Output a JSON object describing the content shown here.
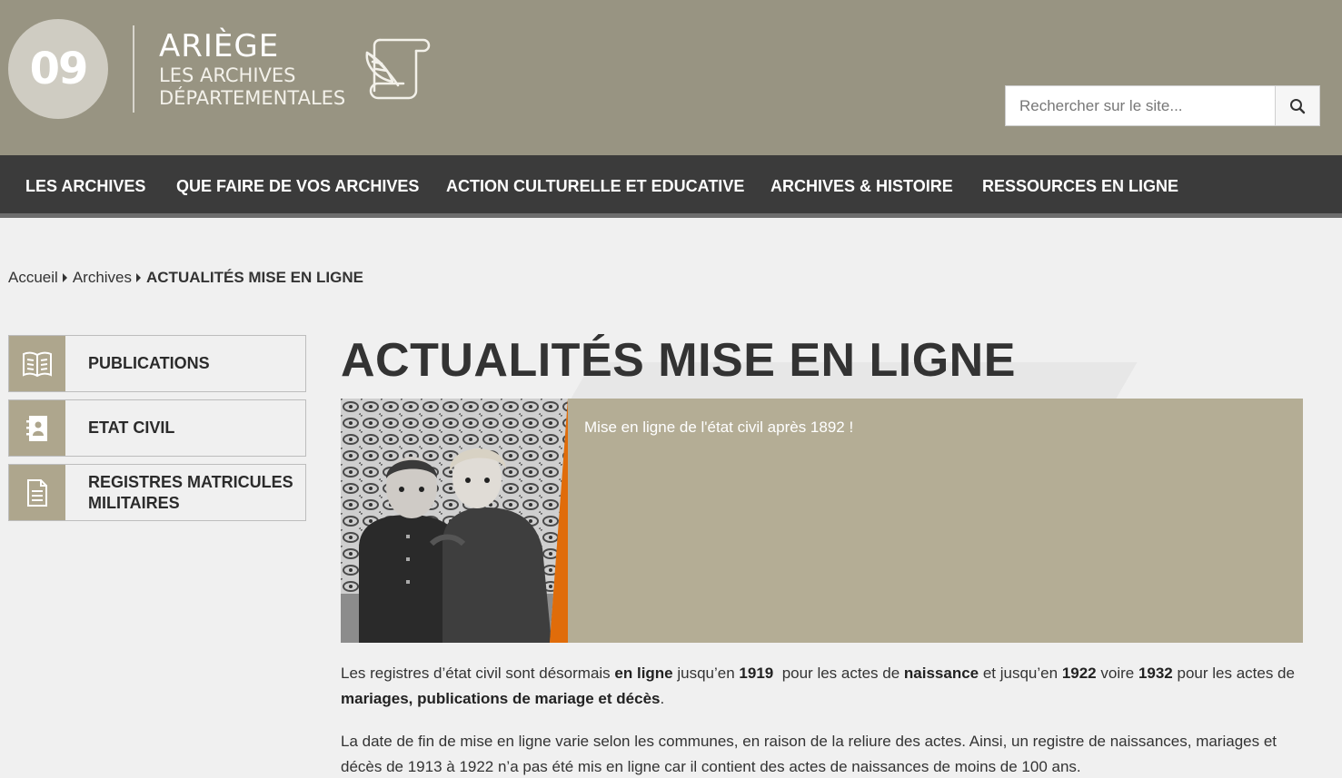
{
  "header": {
    "logo_number": "09",
    "logo_title": "ARIÈGE",
    "logo_sub_1": "LES ARCHIVES",
    "logo_sub_2": "DÉPARTEMENTALES",
    "search_placeholder": "Rechercher sur le site..."
  },
  "nav": {
    "items": [
      "LES ARCHIVES",
      "QUE FAIRE DE VOS ARCHIVES",
      "ACTION CULTURELLE ET EDUCATIVE",
      "ARCHIVES & HISTOIRE",
      "RESSOURCES EN LIGNE"
    ]
  },
  "breadcrumb": {
    "home": "Accueil",
    "parent": "Archives",
    "current": "ACTUALITÉS MISE EN LIGNE"
  },
  "sidebar": {
    "items": [
      {
        "label": "PUBLICATIONS",
        "icon": "book-icon"
      },
      {
        "label": "ETAT CIVIL",
        "icon": "contact-book-icon"
      },
      {
        "label_1": "REGISTRES MATRICULES",
        "label_2": "MILITAIRES",
        "icon": "document-icon"
      }
    ]
  },
  "main": {
    "title": "ACTUALITÉS MISE EN LIGNE",
    "banner_text": "Mise en ligne de l'état civil après 1892 !",
    "para1": {
      "t1": "Les registres d’état civil sont désormais ",
      "b1": "en ligne",
      "t2": " jusqu’en ",
      "b2": "1919",
      "t3": "  pour les actes de ",
      "b3": "naissance",
      "t4": " et jusqu’en ",
      "b4": "1922",
      "t5": " voire ",
      "b5": "1932",
      "t6": " pour les actes de ",
      "b6": "mariages, publications de mariage et décès",
      "t7": "."
    },
    "para2": "La date de fin de mise en ligne varie selon les communes, en raison de la reliure des actes. Ainsi, un registre de naissances, mariages et décès de 1913 à 1922 n’a pas été mis en ligne car il contient des actes de naissances de moins de 100 ans."
  },
  "colors": {
    "header_bg": "#989482",
    "nav_bg": "#3b3b3b",
    "accent_tan": "#b4ad95",
    "accent_orange": "#e06c0a"
  }
}
